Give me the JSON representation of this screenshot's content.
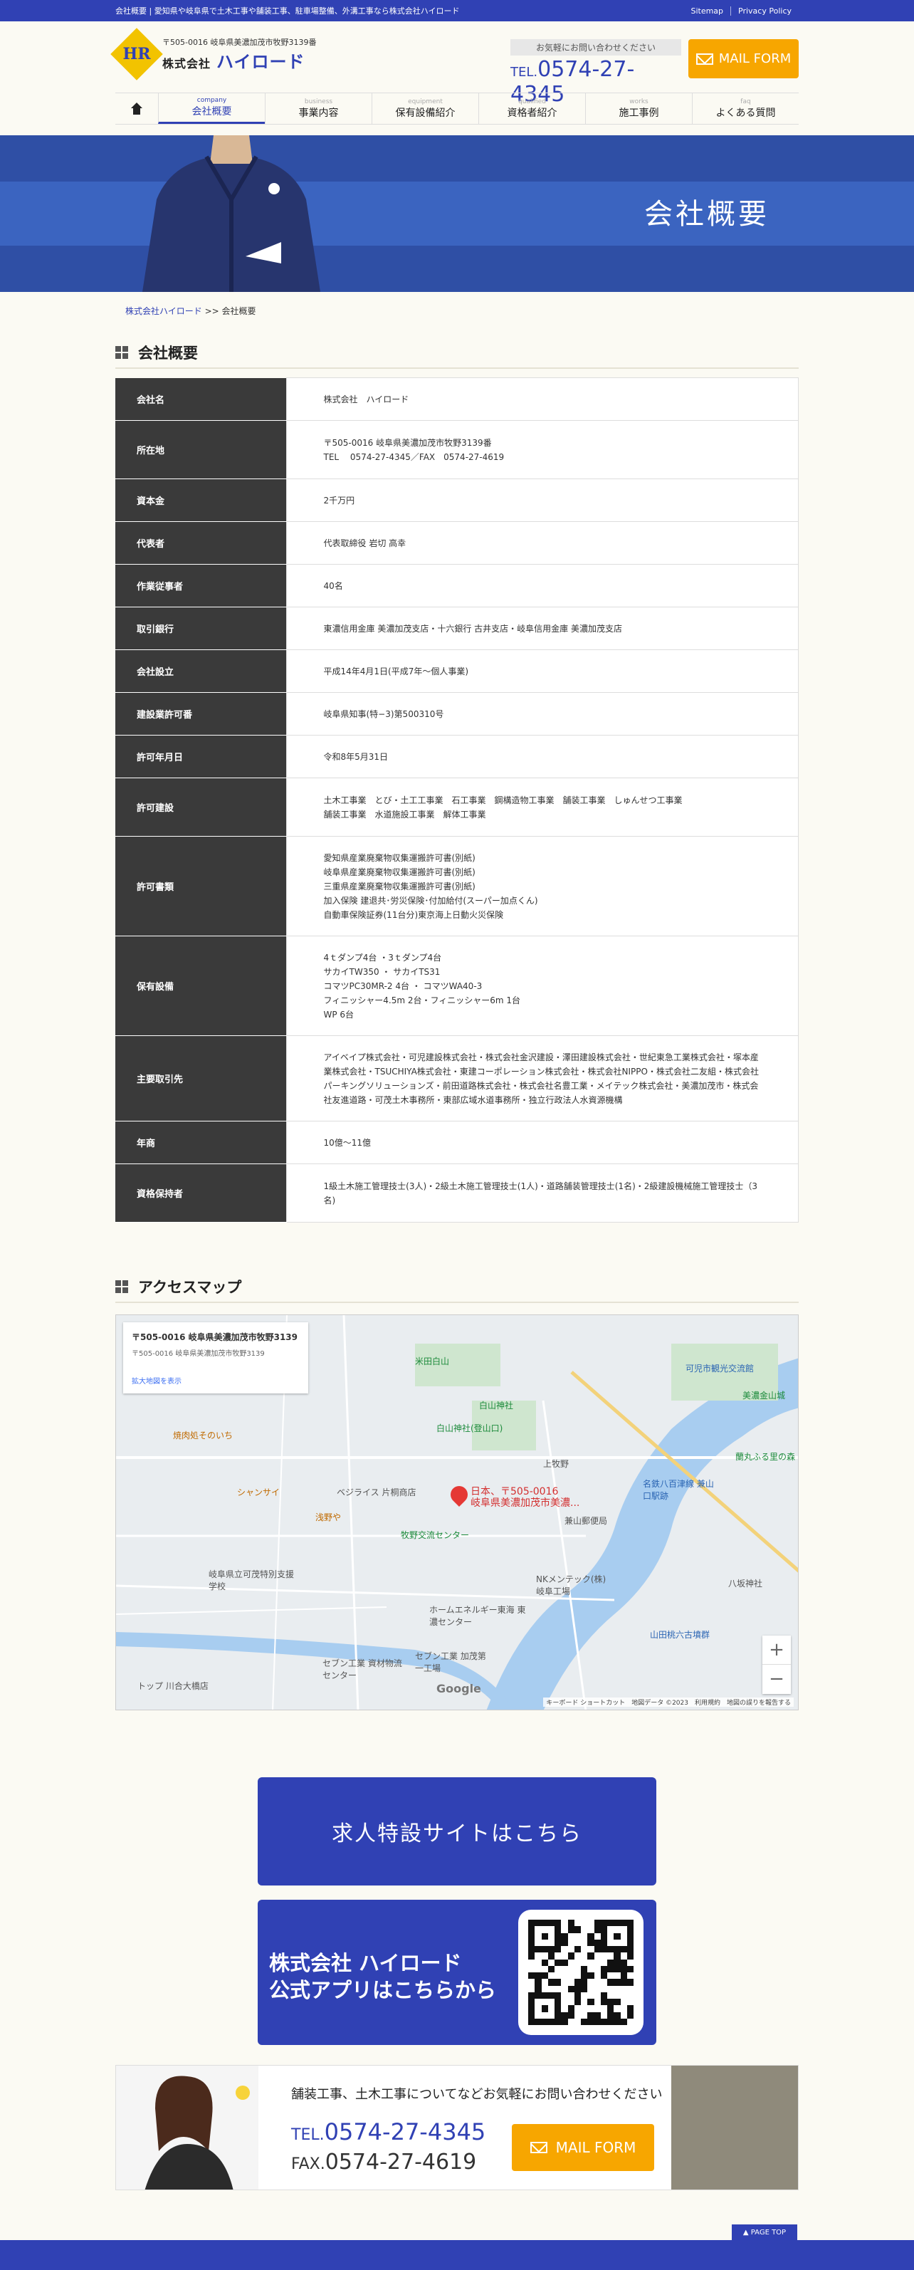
{
  "topbar": {
    "tagline": "会社概要 | 愛知県や岐阜県で土木工事や舗装工事、駐車場整備、外溝工事なら株式会社ハイロード",
    "links": [
      "Sitemap",
      "Privacy Policy"
    ]
  },
  "header": {
    "logo_mark": "HR",
    "address": "〒505-0016 岐阜県美濃加茂市牧野3139番",
    "company_prefix": "株式会社",
    "company_name": "ハイロード",
    "contact_note": "お気軽にお問い合わせください",
    "tel_prefix": "TEL.",
    "tel": "0574-27-4345",
    "mail_button": "MAIL FORM"
  },
  "nav": [
    {
      "en": "",
      "jp": "",
      "name": "home"
    },
    {
      "en": "company",
      "jp": "会社概要",
      "name": "company"
    },
    {
      "en": "business",
      "jp": "事業内容",
      "name": "business"
    },
    {
      "en": "equipment",
      "jp": "保有設備紹介",
      "name": "equipment"
    },
    {
      "en": "qualified",
      "jp": "資格者紹介",
      "name": "qualified"
    },
    {
      "en": "works",
      "jp": "施工事例",
      "name": "works"
    },
    {
      "en": "faq",
      "jp": "よくある質問",
      "name": "faq"
    }
  ],
  "hero": {
    "title": "会社概要"
  },
  "breadcrumb": {
    "home": "株式会社ハイロード",
    "sep": ">>",
    "current": "会社概要"
  },
  "section1": {
    "title": "会社概要"
  },
  "company_table": [
    {
      "label": "会社名",
      "value": "株式会社　ハイロード"
    },
    {
      "label": "所在地",
      "value": "〒505-0016 岐阜県美濃加茂市牧野3139番\nTEL　 0574-27-4345／FAX　0574-27-4619"
    },
    {
      "label": "資本金",
      "value": "2千万円"
    },
    {
      "label": "代表者",
      "value": "代表取締役 岩切 高幸"
    },
    {
      "label": "作業従事者",
      "value": "40名"
    },
    {
      "label": "取引銀行",
      "value": "東濃信用金庫 美濃加茂支店・十六銀行 古井支店・岐阜信用金庫 美濃加茂支店"
    },
    {
      "label": "会社設立",
      "value": "平成14年4月1日(平成7年〜個人事業)"
    },
    {
      "label": "建設業許可番",
      "value": "岐阜県知事(特−3)第500310号"
    },
    {
      "label": "許可年月日",
      "value": "令和8年5月31日"
    },
    {
      "label": "許可建設",
      "value": "土木工事業　とび・土工工事業　石工事業　鋼構造物工事業　舗装工事業　しゅんせつ工事業\n舗装工事業　水道施設工事業　解体工事業"
    },
    {
      "label": "許可書類",
      "value": "愛知県産業廃棄物収集運搬許可書(別紙)\n岐阜県産業廃棄物収集運搬許可書(別紙)\n三重県産業廃棄物収集運搬許可書(別紙)\n加入保険 建退共･労災保険･付加給付(スーパー加点くん)\n自動車保険証券(11台分)東京海上日動火災保険"
    },
    {
      "label": "保有設備",
      "value": "4ｔダンプ4台 ・3ｔダンプ4台\nサカイTW350 ・ サカイTS31\nコマツPC30MR-2 4台 ・ コマツWA40-3\nフィニッシャー4.5m 2台・フィニッシャー6m 1台\nWP 6台"
    },
    {
      "label": "主要取引先",
      "value": "アイベイプ株式会社・可児建設株式会社・株式会社金沢建設・澤田建設株式会社・世紀東急工業株式会社・塚本産業株式会社・TSUCHIYA株式会社・東建コーポレーション株式会社・株式会社NIPPO・株式会社二友組・株式会社パーキングソリューションズ・前田道路株式会社・株式会社名豊工業・メイテック株式会社・美濃加茂市・株式会社友進道路・可茂土木事務所・東部広域水道事務所・独立行政法人水資源機構"
    },
    {
      "label": "年商",
      "value": "10億〜11億"
    },
    {
      "label": "資格保持者",
      "value": "1級土木施工管理技士(3人)・2級土木施工管理技士(1人)・道路舗装管理技士(1名)・2級建設機械施工管理技士（3名)"
    }
  ],
  "section2": {
    "title": "アクセスマップ"
  },
  "map": {
    "card_title": "〒505-0016 岐阜県美濃加茂市牧野3139",
    "card_sub": "〒505-0016 岐阜県美濃加茂市牧野3139",
    "card_link": "拡大地図を表示",
    "pin_label": "日本、〒505-0016\n岐阜県美濃加茂市美濃...",
    "labels": [
      "米田白山",
      "白山神社",
      "白山神社(登山口)",
      "上牧野",
      "可児市観光交流館",
      "美濃金山城",
      "名鉄八百津線 兼山口駅跡",
      "蘭丸ふる里の森",
      "ベジライス 片桐商店",
      "牧野交流センター",
      "浅野や",
      "NKメンテック(株) 岐阜工場",
      "兼山郵便局",
      "岐阜県立可茂特別支援学校",
      "ホームエネルギー東海 東濃センター",
      "セブン工業 資材物流センター",
      "セブン工業 加茂第一工場",
      "山田桃六古墳群",
      "八坂神社",
      "トップ 川合大橋店",
      "焼肉処そのいち",
      "シャンサイ"
    ],
    "zoom_in": "+",
    "zoom_out": "−",
    "google": "Google",
    "footer": "キーボード ショートカット　地図データ ©2023　利用規約　地図の誤りを報告する"
  },
  "recruit_button": "求人特設サイトはこちら",
  "app_button": {
    "line1": "株式会社 ハイロード",
    "line2": "公式アプリはこちらから"
  },
  "contact_box": {
    "message": "舗装工事、土木工事についてなどお気軽にお問い合わせください",
    "tel_prefix": "TEL.",
    "tel": "0574-27-4345",
    "fax_prefix": "FAX.",
    "fax": "0574-27-4619",
    "mail_button": "MAIL FORM"
  },
  "pagetop": "▲ PAGE TOP",
  "colors": {
    "brand": "#3041b4",
    "accent": "#f7a600",
    "table_header": "#3a3a3a"
  }
}
